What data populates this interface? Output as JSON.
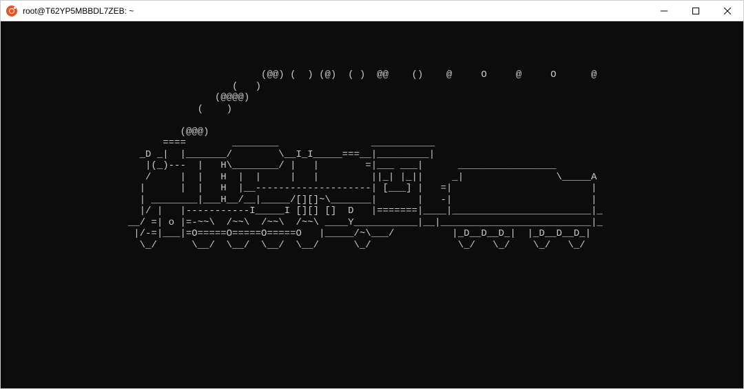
{
  "window": {
    "title": "root@T62YP5MBBDL7ZEB: ~"
  },
  "terminal": {
    "lines": [
      "                                             (@@) (  ) (@)  ( )  @@    ()    @     O     @     O      @",
      "                                        (   )",
      "                                     (@@@@)",
      "                                  (    )",
      "",
      "                               (@@@)",
      "                            ====        ________                ___________",
      "                        _D _|  |_______/        \\__I_I_____===__|_________|",
      "                         |(_)---  |   H\\________/ |   |        =|___ ___|      _________________",
      "                         /     |  |   H  |  |     |   |         ||_| |_||     _|                \\_____A",
      "                        |      |  |   H  |__--------------------| [___] |   =|                        |",
      "                        | ________|___H__/__|_____/[][]~\\_______|       |   -|                        |",
      "                        |/ |   |-----------I_____I [][] []  D   |=======|____|________________________|_",
      "                      __/ =| o |=-~~\\  /~~\\  /~~\\  /~~\\ ____Y___________|__|__________________________|_",
      "                       |/-=|___|=O=====O=====O=====O   |_____/~\\___/          |_D__D__D_|  |_D__D__D_|",
      "                        \\_/      \\__/  \\__/  \\__/  \\__/      \\_/               \\_/   \\_/    \\_/   \\_/"
    ]
  }
}
